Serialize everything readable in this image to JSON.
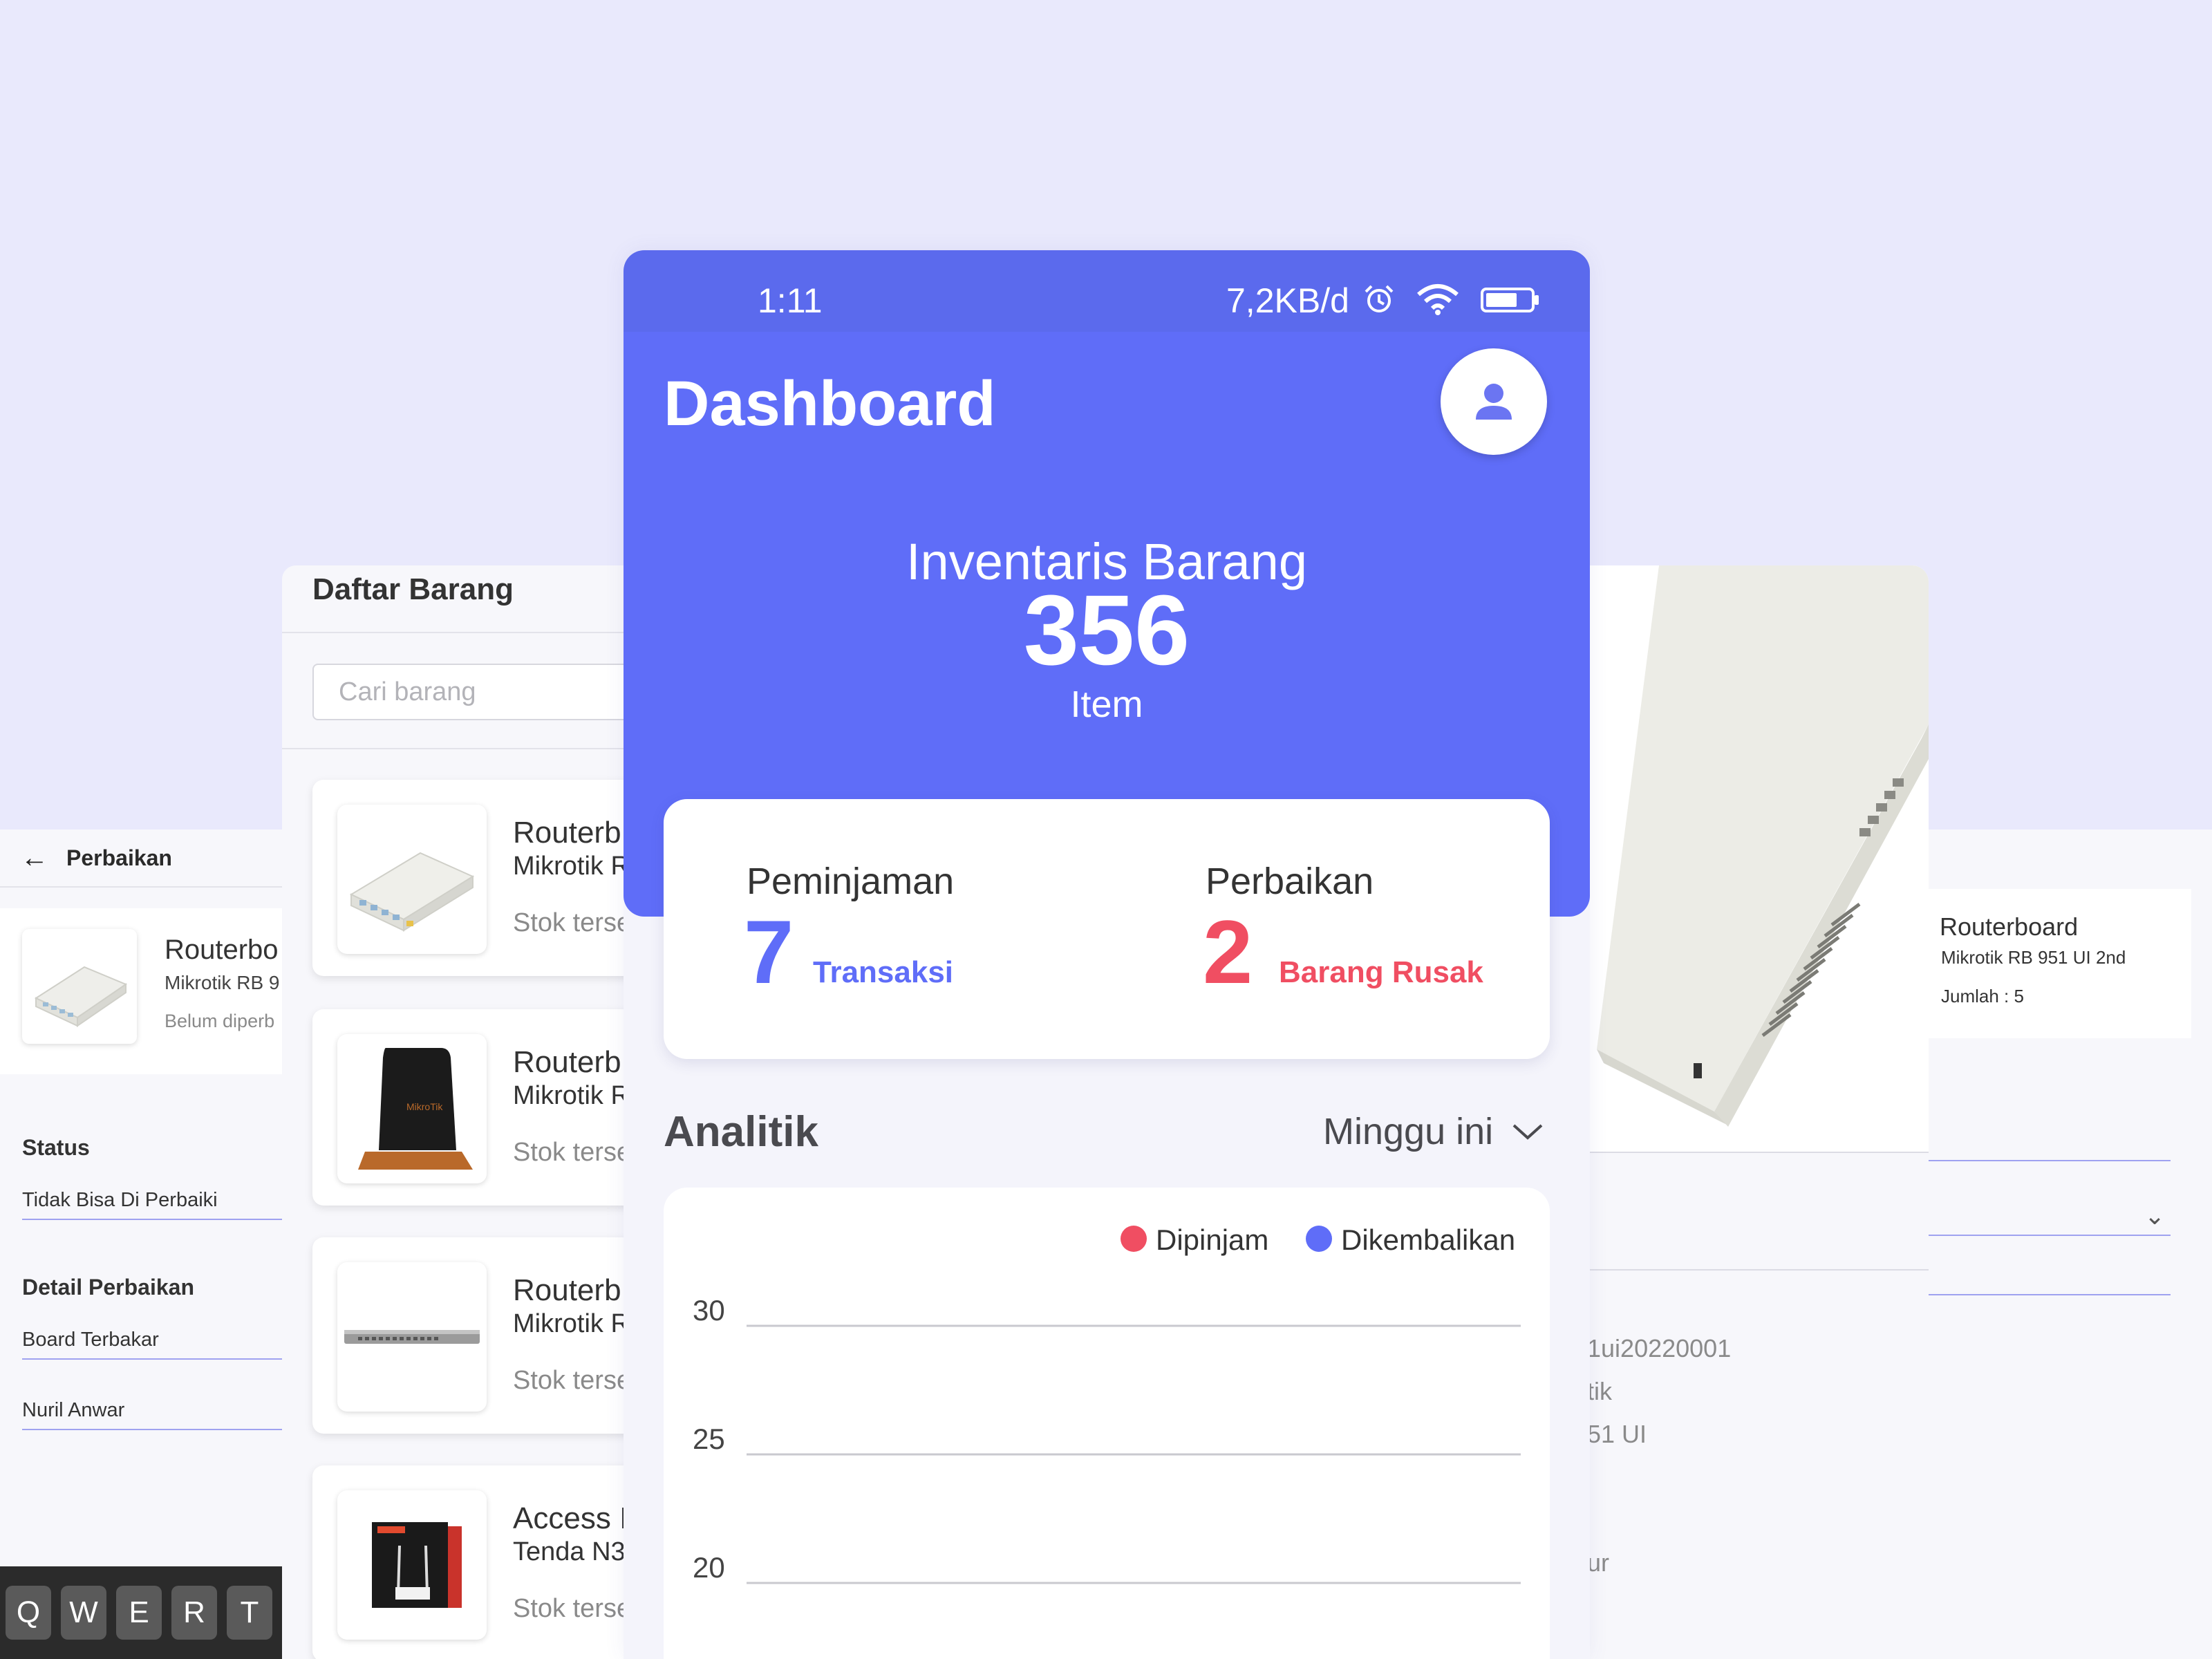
{
  "perbaikan": {
    "title": "Perbaikan",
    "item_name": "Routerbo",
    "item_sub": "Mikrotik RB 9",
    "item_note": "Belum diperb",
    "status_label": "Status",
    "status_value": "Tidak Bisa Di Perbaiki",
    "detail_label": "Detail Perbaikan",
    "detail_value": "Board Terbakar",
    "person_value": "Nuril Anwar"
  },
  "keyboard": {
    "keys": [
      "Q",
      "W",
      "E",
      "R",
      "T"
    ]
  },
  "daftar": {
    "title": "Daftar Barang",
    "search_placeholder": "Cari barang",
    "items": [
      {
        "name": "Routerb",
        "sub": "Mikrotik R",
        "stock": "Stok terse"
      },
      {
        "name": "Routerb",
        "sub": "Mikrotik R",
        "stock": "Stok terse"
      },
      {
        "name": "Routerb",
        "sub": "Mikrotik R",
        "stock": "Stok terse"
      },
      {
        "name": "Access I",
        "sub": "Tenda N3",
        "stock": "Stok terse"
      }
    ]
  },
  "detail": {
    "code": "1ui20220001",
    "brand": "tik",
    "model": "51 UI",
    "other": "ur"
  },
  "rightpanel": {
    "name": "Routerboard",
    "model": "Mikrotik RB 951 UI 2nd",
    "qty": "Jumlah  : 5"
  },
  "status_bar": {
    "time": "1:11",
    "network": "7,2KB/d"
  },
  "dashboard": {
    "title": "Dashboard",
    "inventory_label": "Inventaris Barang",
    "inventory_count": "356",
    "inventory_unit": "Item",
    "peminjaman_label": "Peminjaman",
    "peminjaman_value": "7",
    "peminjaman_unit": "Transaksi",
    "perbaikan_label": "Perbaikan",
    "perbaikan_value": "2",
    "perbaikan_unit": "Barang Rusak",
    "analytics_title": "Analitik",
    "filter_value": "Minggu ini"
  },
  "colors": {
    "primary": "#5f6df8",
    "accent_red": "#f04e62",
    "background": "#e9e9fc"
  },
  "chart_data": {
    "type": "line",
    "title": "",
    "series": [
      {
        "name": "Dipinjam",
        "color": "#f04e62",
        "values": []
      },
      {
        "name": "Dikembalikan",
        "color": "#5f6df8",
        "values": []
      }
    ],
    "y_ticks": [
      30,
      25,
      20
    ],
    "ylim": [
      20,
      30
    ],
    "grid": true,
    "legend": "top-right"
  }
}
